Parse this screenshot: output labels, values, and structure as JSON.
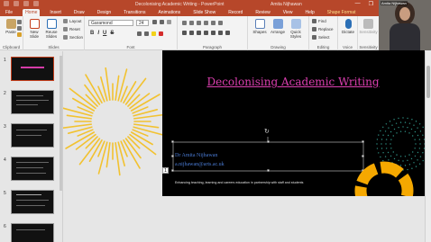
{
  "titlebar": {
    "doc_title": "Decolonising Academic Writing - PowerPoint",
    "account": "Amita Nijhawan",
    "minimize_glyph": "—",
    "restore_glyph": "❐",
    "close_glyph": "✕"
  },
  "tabs": [
    "File",
    "Home",
    "Insert",
    "Draw",
    "Design",
    "Transitions",
    "Animations",
    "Slide Show",
    "Record",
    "Review",
    "View",
    "Help",
    "Shape Format"
  ],
  "ribbon": {
    "clipboard": {
      "paste": "Paste",
      "label": "Clipboard"
    },
    "slides": {
      "new_slide": "New Slide",
      "reuse": "Reuse Slides",
      "layout": "Layout",
      "reset": "Reset",
      "section": "Section",
      "label": "Slides"
    },
    "font": {
      "name": "Garamond",
      "size": "24",
      "bold": "B",
      "italic": "I",
      "underline": "U",
      "strike": "S",
      "label": "Font"
    },
    "paragraph": {
      "label": "Paragraph"
    },
    "drawing": {
      "shapes": "Shapes",
      "arrange": "Arrange",
      "quick_styles": "Quick Styles",
      "label": "Drawing"
    },
    "editing": {
      "find": "Find",
      "replace": "Replace",
      "select": "Select",
      "label": "Editing"
    },
    "voice": {
      "dictate": "Dictate",
      "label": "Voice"
    },
    "sensitivity": {
      "btn": "Sensitivity",
      "label": "Sensitivity"
    },
    "designer": {
      "btn": "Designer",
      "label": "Designer"
    }
  },
  "webcam": {
    "name": "Amita Nijhawan"
  },
  "thumbnails": [
    {
      "num": "1"
    },
    {
      "num": "2"
    },
    {
      "num": "3"
    },
    {
      "num": "4"
    },
    {
      "num": "5"
    },
    {
      "num": "6"
    }
  ],
  "slide": {
    "title": "Decolonising Academic Writing",
    "author": "Dr Amita Nijhawan",
    "email": "a.nijhawan@arts.ac.uk",
    "tagline": "Enhancing teaching, learning and careers education in partnership with staff and students"
  },
  "colors": {
    "accent": "#b7472a",
    "title_pink": "#dc3fb0",
    "sunburst_yellow": "#f2c230",
    "ring_orange": "#f5a800",
    "text_blue": "#4a7bd4"
  }
}
